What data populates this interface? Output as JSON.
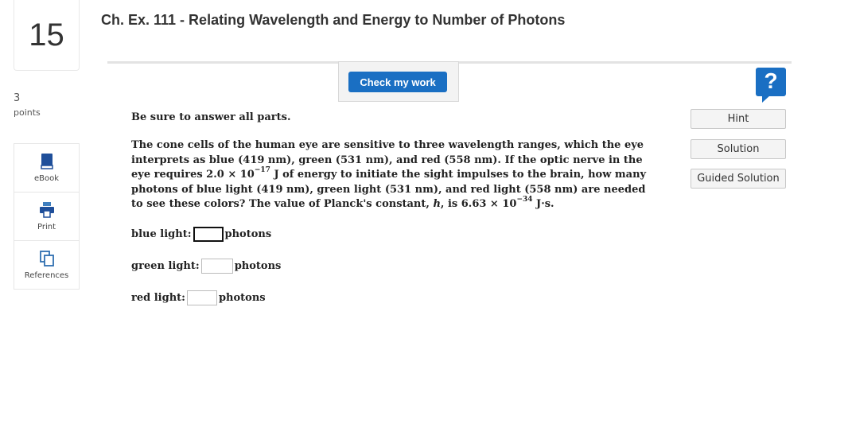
{
  "question": {
    "number": "15",
    "title": "Ch. Ex. 111 - Relating Wavelength and Energy to Number of Photons",
    "points_value": "3",
    "points_label": "points"
  },
  "tools": [
    {
      "label": "eBook",
      "icon": "book-icon"
    },
    {
      "label": "Print",
      "icon": "printer-icon"
    },
    {
      "label": "References",
      "icon": "copy-icon"
    }
  ],
  "toolbar": {
    "check_label": "Check my work",
    "help_symbol": "?"
  },
  "side_buttons": [
    "Hint",
    "Solution",
    "Guided Solution"
  ],
  "body": {
    "instruction": "Be sure to answer all parts.",
    "p1": "The cone cells of the human eye are sensitive to three wavelength ranges, which the eye interprets as blue (419 nm), green (531 nm), and red (558 nm). If the optic nerve in the eye requires 2.0 × 10",
    "exp1": "−17",
    "p2": " J of energy to initiate the sight impulses to the brain, how many photons of blue light (419 nm), green light (531 nm), and red light (558 nm) are needed to see these colors? The value of Planck's constant, ",
    "h": "h",
    "p3": ", is 6.63 × 10",
    "exp2": "−34",
    "p4": " J·s."
  },
  "answers": [
    {
      "label": "blue light:",
      "value": "",
      "unit": "photons"
    },
    {
      "label": "green light:",
      "value": "",
      "unit": "photons"
    },
    {
      "label": "red light:",
      "value": "",
      "unit": "photons"
    }
  ],
  "colors": {
    "accent": "#1a6fc3",
    "ebook_icon": "#1f4f9a",
    "print_icon": "#3f7fbf",
    "ref_icon": "#2f6fb0"
  }
}
